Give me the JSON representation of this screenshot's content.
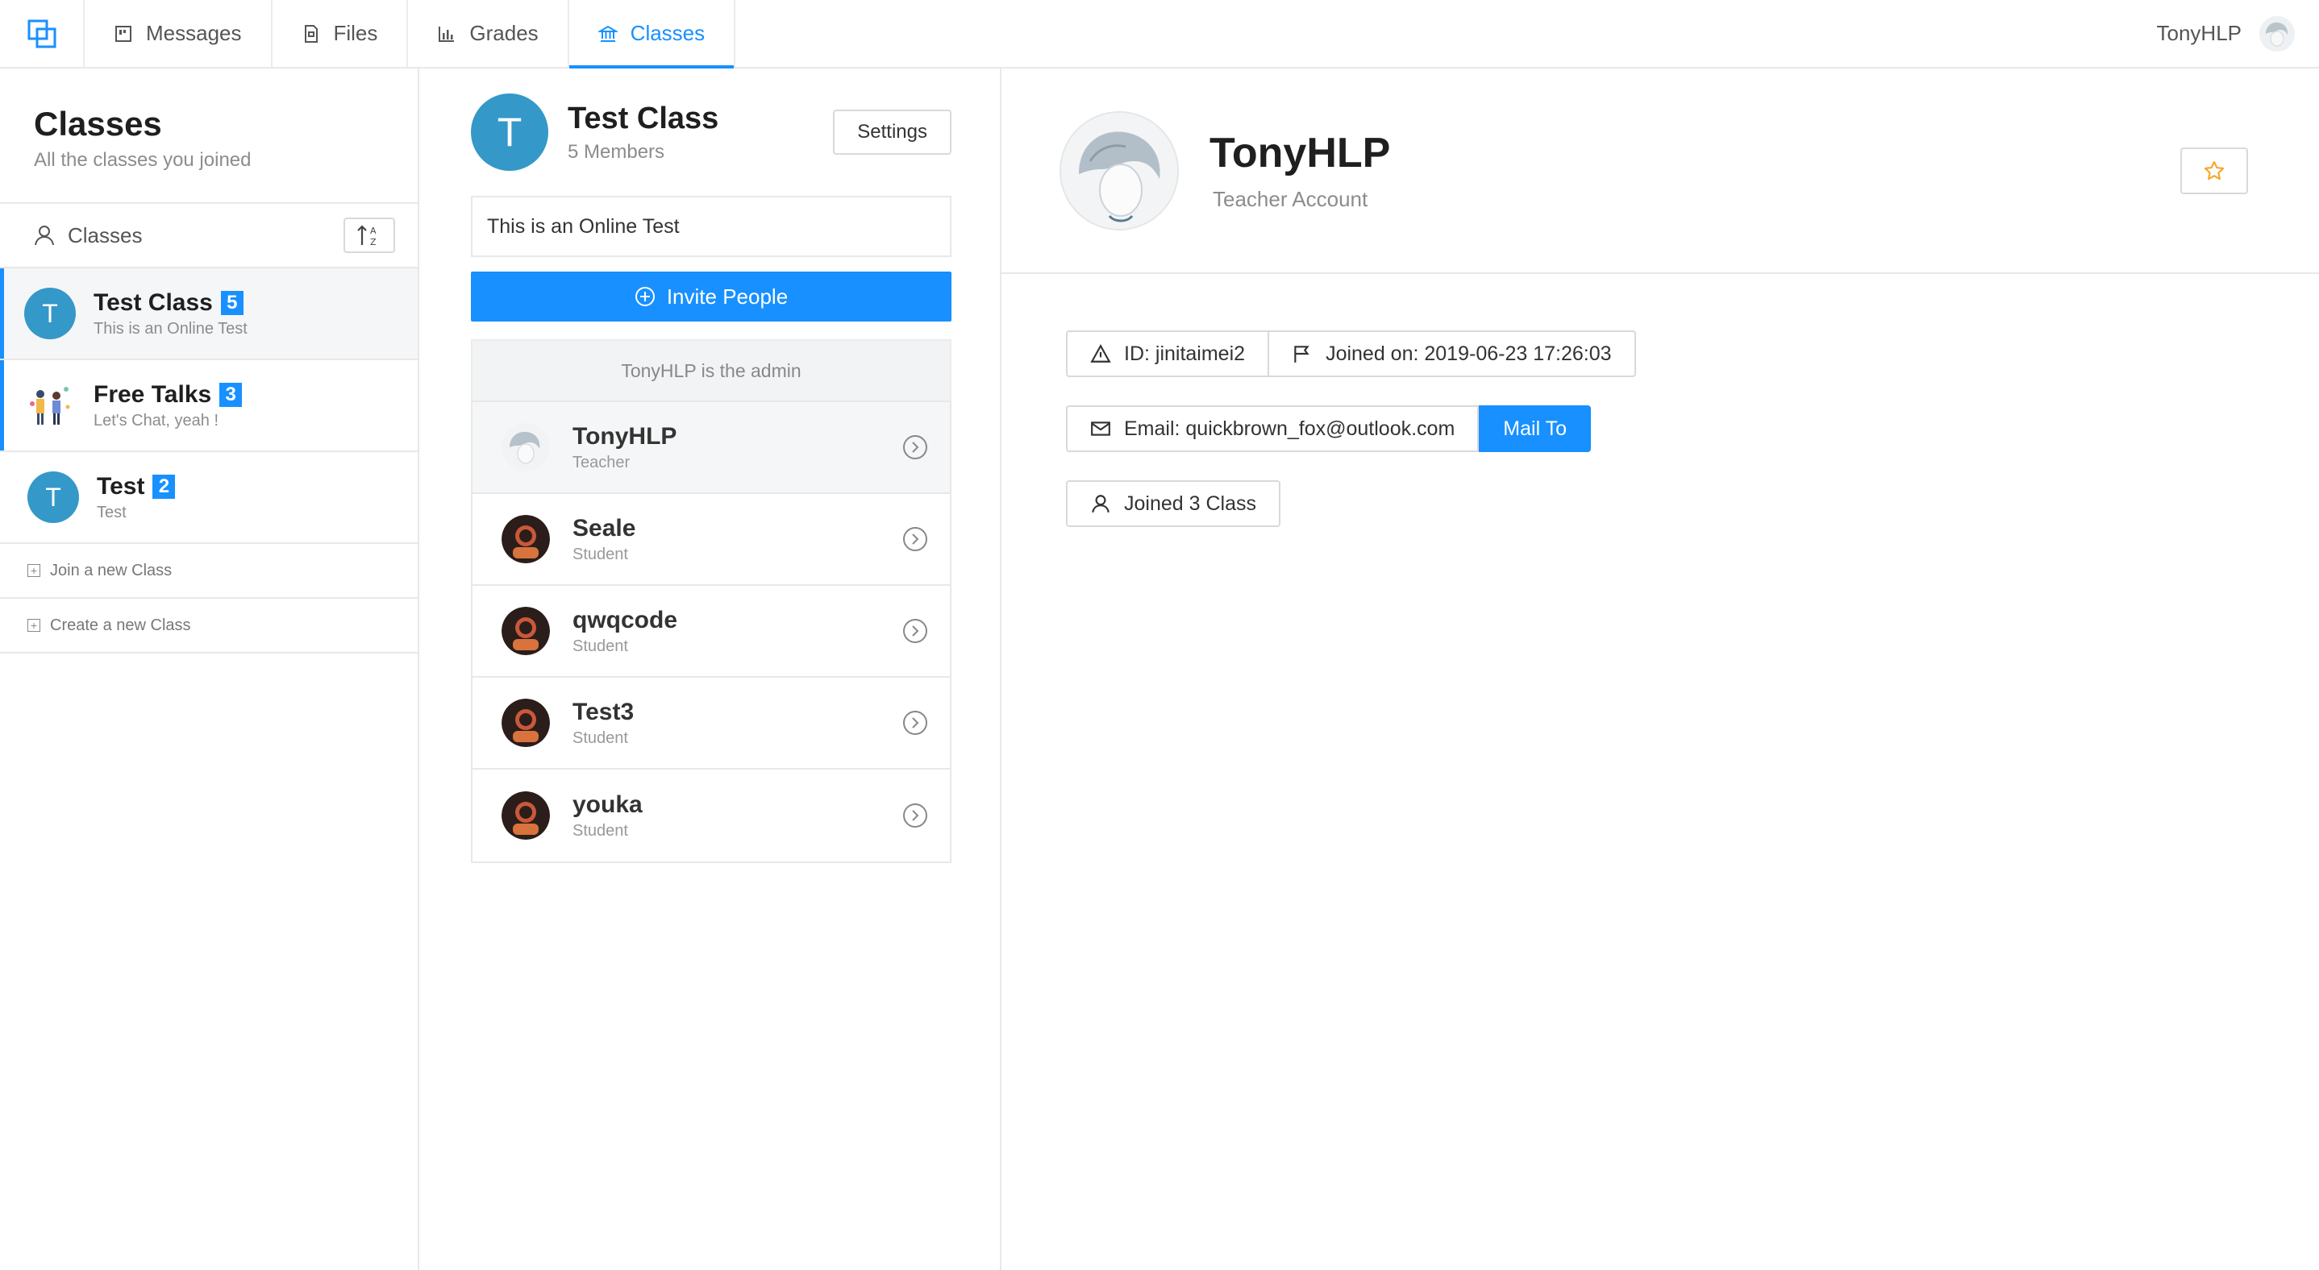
{
  "nav": {
    "tabs": [
      {
        "label": "Messages",
        "icon": "messages-icon"
      },
      {
        "label": "Files",
        "icon": "files-icon"
      },
      {
        "label": "Grades",
        "icon": "bar-chart-icon"
      },
      {
        "label": "Classes",
        "icon": "bank-icon",
        "active": true
      }
    ],
    "username": "TonyHLP",
    "accent": "#1890ff"
  },
  "sidebar": {
    "title": "Classes",
    "subtitle": "All the classes you joined",
    "toolbar_label": "Classes",
    "classes": [
      {
        "initial": "T",
        "name": "Test Class",
        "count": "5",
        "desc": "This is an Online Test"
      },
      {
        "initial": "",
        "name": "Free Talks",
        "count": "3",
        "desc": "Let's Chat, yeah !"
      },
      {
        "initial": "T",
        "name": "Test",
        "count": "2",
        "desc": "Test"
      }
    ],
    "actions": {
      "join": "Join a new Class",
      "create": "Create a new Class"
    }
  },
  "class_panel": {
    "initial": "T",
    "title": "Test Class",
    "members_count": "5 Members",
    "settings_label": "Settings",
    "description": "This is an Online Test",
    "invite_label": "Invite People",
    "admin_note": "TonyHLP is the admin",
    "members": [
      {
        "name": "TonyHLP",
        "role": "Teacher"
      },
      {
        "name": "Seale",
        "role": "Student"
      },
      {
        "name": "qwqcode",
        "role": "Student"
      },
      {
        "name": "Test3",
        "role": "Student"
      },
      {
        "name": "youka",
        "role": "Student"
      }
    ]
  },
  "profile": {
    "name": "TonyHLP",
    "account_type": "Teacher Account",
    "id": "ID: jinitaimei2",
    "joined_on": "Joined on: 2019-06-23 17:26:03",
    "email": "Email: quickbrown_fox@outlook.com",
    "mail_to_label": "Mail To",
    "joined_classes": "Joined 3 Class"
  }
}
